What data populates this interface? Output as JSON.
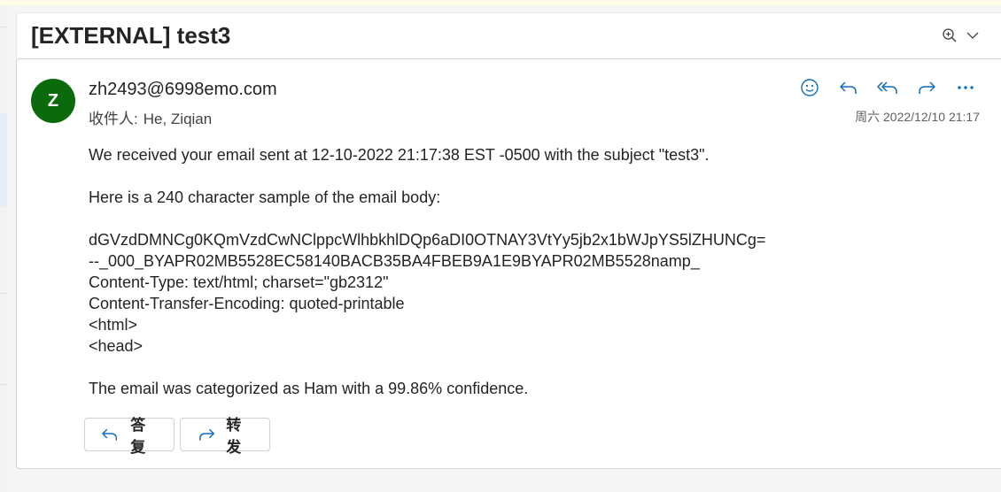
{
  "subject": "[EXTERNAL] test3",
  "toolbar": {
    "zoom_icon": "zoom-in-icon",
    "expand_icon": "chevron-down-icon"
  },
  "message": {
    "avatar_initial": "Z",
    "avatar_color": "#0b6a0b",
    "sender": "zh2493@6998emo.com",
    "recipient_label": "收件人:",
    "recipient_name": "He, Ziqian",
    "date": "周六 2022/12/10 21:17",
    "actions": [
      "emoji-icon",
      "reply-icon",
      "reply-all-icon",
      "forward-icon",
      "more-icon"
    ],
    "body": {
      "line1": "We received your email sent at 12-10-2022 21:17:38 EST -0500 with the subject \"test3\".",
      "line2": "Here is a 240 character sample of the email body:",
      "sample": [
        "dGVzdDMNCg0KQmVzdCwNClppcWlhbkhlDQp6aDI0OTNAY3VtYy5jb2x1bWJpYS5lZHUNCg=",
        "--_000_BYAPR02MB5528EC58140BACB35BA4FBEB9A1E9BYAPR02MB5528namp_",
        "Content-Type: text/html; charset=\"gb2312\"",
        "Content-Transfer-Encoding: quoted-printable",
        "<html>",
        "<head>"
      ],
      "line3": "The email was categorized as Ham with a 99.86% confidence."
    },
    "buttons": {
      "reply": "答复",
      "forward": "转发"
    }
  },
  "colors": {
    "accent": "#0f6cbd",
    "avatar": "#0b6a0b"
  }
}
